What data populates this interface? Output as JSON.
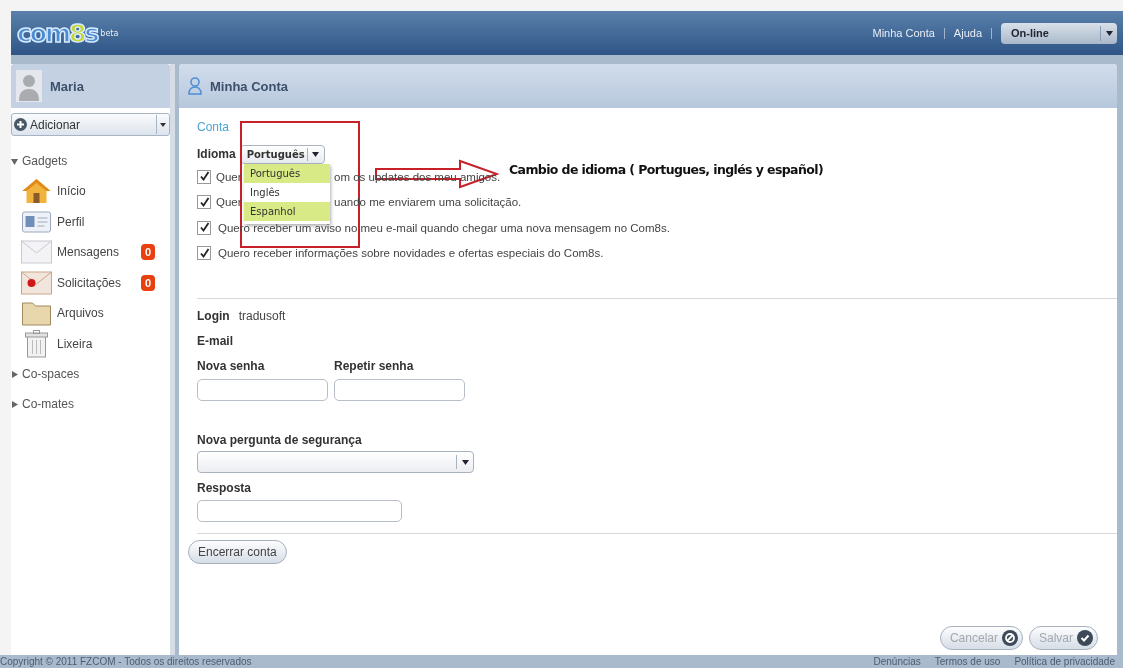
{
  "header": {
    "logo": {
      "word_start": "com",
      "digit": "8",
      "word_end": "s",
      "tag": "beta"
    },
    "links": [
      "Minha Conta",
      "Ajuda"
    ],
    "status": {
      "value": "On-line"
    }
  },
  "sidebar": {
    "user": {
      "name": "Maria"
    },
    "add_button": "Adicionar",
    "tree": [
      {
        "label": "Gadgets",
        "expanded": true,
        "children": [
          {
            "label": "Início",
            "kind": "home"
          },
          {
            "label": "Perfil",
            "kind": "profile"
          },
          {
            "label": "Mensagens",
            "kind": "mail",
            "badge": "0"
          },
          {
            "label": "Solicitações",
            "kind": "request",
            "badge": "0"
          },
          {
            "label": "Arquivos",
            "kind": "folder"
          },
          {
            "label": "Lixeira",
            "kind": "trash"
          }
        ]
      },
      {
        "label": "Co-spaces",
        "expanded": false
      },
      {
        "label": "Co-mates",
        "expanded": false
      }
    ]
  },
  "panel": {
    "title": "Minha Conta",
    "section": "Conta",
    "language": {
      "label": "Idioma",
      "value": "Português",
      "open": true,
      "options": [
        {
          "label": "Português",
          "highlighted": true
        },
        {
          "label": "Inglês",
          "highlighted": false
        },
        {
          "label": "Espanhol",
          "highlighted": true
        }
      ]
    },
    "options": [
      {
        "checked": true,
        "segments": [
          "Quer",
          "om os updates dos meu amigos."
        ]
      },
      {
        "checked": true,
        "segments": [
          "Quer",
          "uando me enviarem uma solicitação."
        ]
      },
      {
        "checked": true,
        "segments": [
          "Quero receber um aviso no meu e-mail quando chegar uma nova mensagem no Com8s."
        ]
      },
      {
        "checked": true,
        "segments": [
          "Quero receber informações sobre novidades e ofertas especiais do Com8s."
        ]
      }
    ],
    "login": {
      "label": "Login",
      "value": "tradusoft"
    },
    "email": {
      "label": "E-mail"
    },
    "new_password": {
      "label": "Nova senha"
    },
    "repeat_password": {
      "label": "Repetir senha"
    },
    "security_question": {
      "label": "Nova pergunta de segurança"
    },
    "answer": {
      "label": "Resposta"
    },
    "close_account": "Encerrar conta",
    "actions": [
      {
        "label": "Cancelar",
        "kind": "cancel",
        "disabled": true
      },
      {
        "label": "Salvar",
        "kind": "save",
        "disabled": true
      }
    ]
  },
  "annotation": {
    "text": "Cambio de idioma ( Portugues, inglés y español)"
  },
  "footer": {
    "copyright": "Copyright © 2011 FZCOM - Todos os direitos reservados",
    "links": [
      "Denúncias",
      "Termos de uso",
      "Política de privacidade"
    ]
  }
}
